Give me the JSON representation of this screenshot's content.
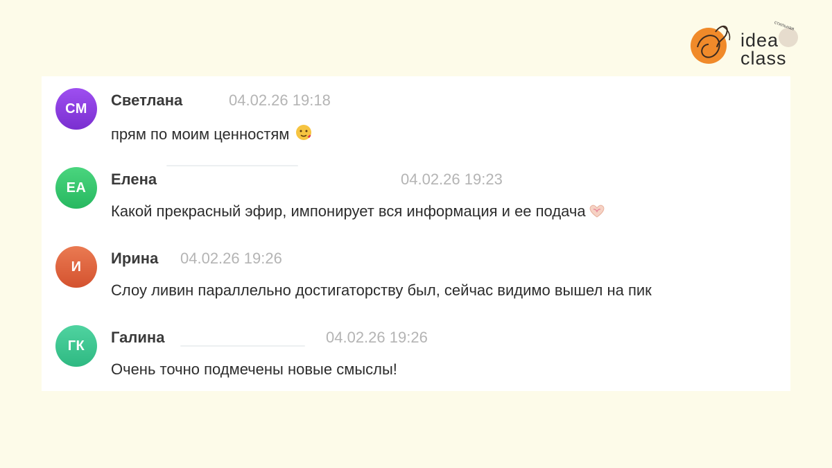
{
  "brand": {
    "line1": "idea",
    "line2": "class",
    "accent_color": "#f08a2a",
    "badge_text": "стильная"
  },
  "messages": [
    {
      "initials": "СМ",
      "author": "Светлана",
      "timestamp": "04.02.26 19:18",
      "text": "прям по моим ценностям",
      "emoji": "face-with-hearts",
      "avatar_color": "#8b3fd9"
    },
    {
      "initials": "ЕА",
      "author": "Елена",
      "timestamp": "04.02.26 19:23",
      "text": "Какой прекрасный эфир, импонирует вся информация и ее подача",
      "emoji": "heart-hands",
      "avatar_color": "#36c86e"
    },
    {
      "initials": "И",
      "author": "Ирина",
      "timestamp": "04.02.26 19:26",
      "text": "Слоу ливин параллельно достигаторству был, сейчас видимо вышел на пик",
      "emoji": "",
      "avatar_color": "#e0623e"
    },
    {
      "initials": "ГК",
      "author": "Галина",
      "timestamp": "04.02.26 19:26",
      "text": "Очень точно подмечены новые смыслы!",
      "emoji": "",
      "avatar_color": "#3ec594"
    }
  ]
}
